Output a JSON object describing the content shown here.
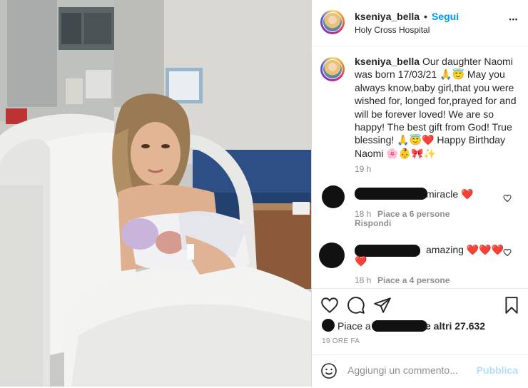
{
  "post": {
    "username": "kseniya_bella",
    "follow_label": "Segui",
    "separator": "•",
    "location": "Holy Cross Hospital",
    "more_label": "•••",
    "caption_text": " Our daughter Naomi was born 17/03/21 🙏😇 May you always know,baby girl,that you were wished for, longed for,prayed for and will be forever loved! We are so happy! The best gift from God! True blessing! 🙏😇❤️ Happy Birthday Naomi 🌸👶🎀✨",
    "caption_time": "19 h"
  },
  "comments": [
    {
      "text": "miracle ❤️",
      "time": "18 h",
      "likes": "Piace a 6 persone",
      "reply_label": "Rispondi"
    },
    {
      "text": "amazing ❤️❤️❤️",
      "text_cont": "❤️",
      "time": "18 h",
      "likes": "Piace a 4 persone"
    }
  ],
  "actions": {
    "likes_prefix": "Piace a",
    "likes_suffix": "e altri 27.632",
    "post_time": "19 ORE FA",
    "comment_placeholder": "Aggiungi un commento...",
    "publish_label": "Pubblica"
  },
  "colors": {
    "accent": "#0095f6",
    "text": "#262626",
    "muted": "#8e8e8e",
    "like_red": "#ed4956",
    "publish_disabled": "#b2dffc"
  }
}
